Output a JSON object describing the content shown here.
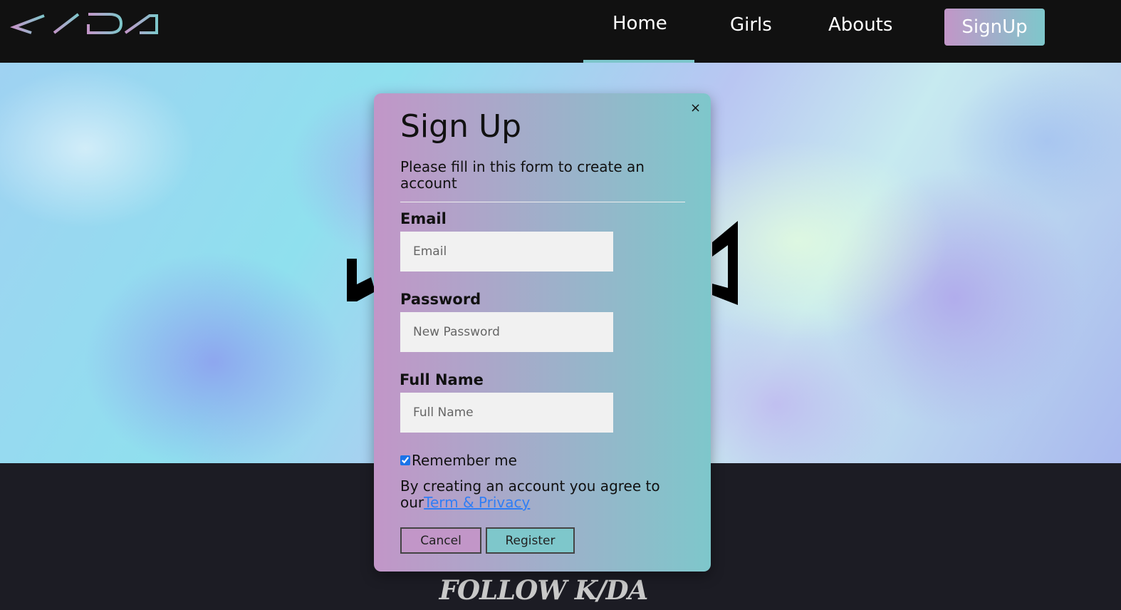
{
  "brand": {
    "logo_text": "K/DA"
  },
  "nav": {
    "items": [
      {
        "label": "Home",
        "active": true
      },
      {
        "label": "Girls"
      },
      {
        "label": "Abouts"
      }
    ],
    "signup_label": "SignUp"
  },
  "modal": {
    "close_label": "×",
    "title": "Sign Up",
    "subtitle": "Please fill in this form to create an account",
    "fields": {
      "email": {
        "label": "Email",
        "placeholder": "Email",
        "value": ""
      },
      "password": {
        "label": "Password",
        "placeholder": "New Password",
        "value": ""
      },
      "full_name": {
        "label": "Full Name",
        "placeholder": "Full Name",
        "value": ""
      }
    },
    "remember": {
      "label": "Remember me",
      "checked": true
    },
    "terms": {
      "prefix": "By creating an account you agree to our",
      "link_label": "Term & Privacy"
    },
    "cancel_label": "Cancel",
    "register_label": "Register"
  },
  "footer": {
    "title": "FOLLOW K/DA"
  },
  "colors": {
    "gradient_start": "#c296c8",
    "gradient_end": "#7ec7cb",
    "nav_bg": "#111111",
    "page_bg": "#1c1c24",
    "link": "#2f7ef5"
  }
}
